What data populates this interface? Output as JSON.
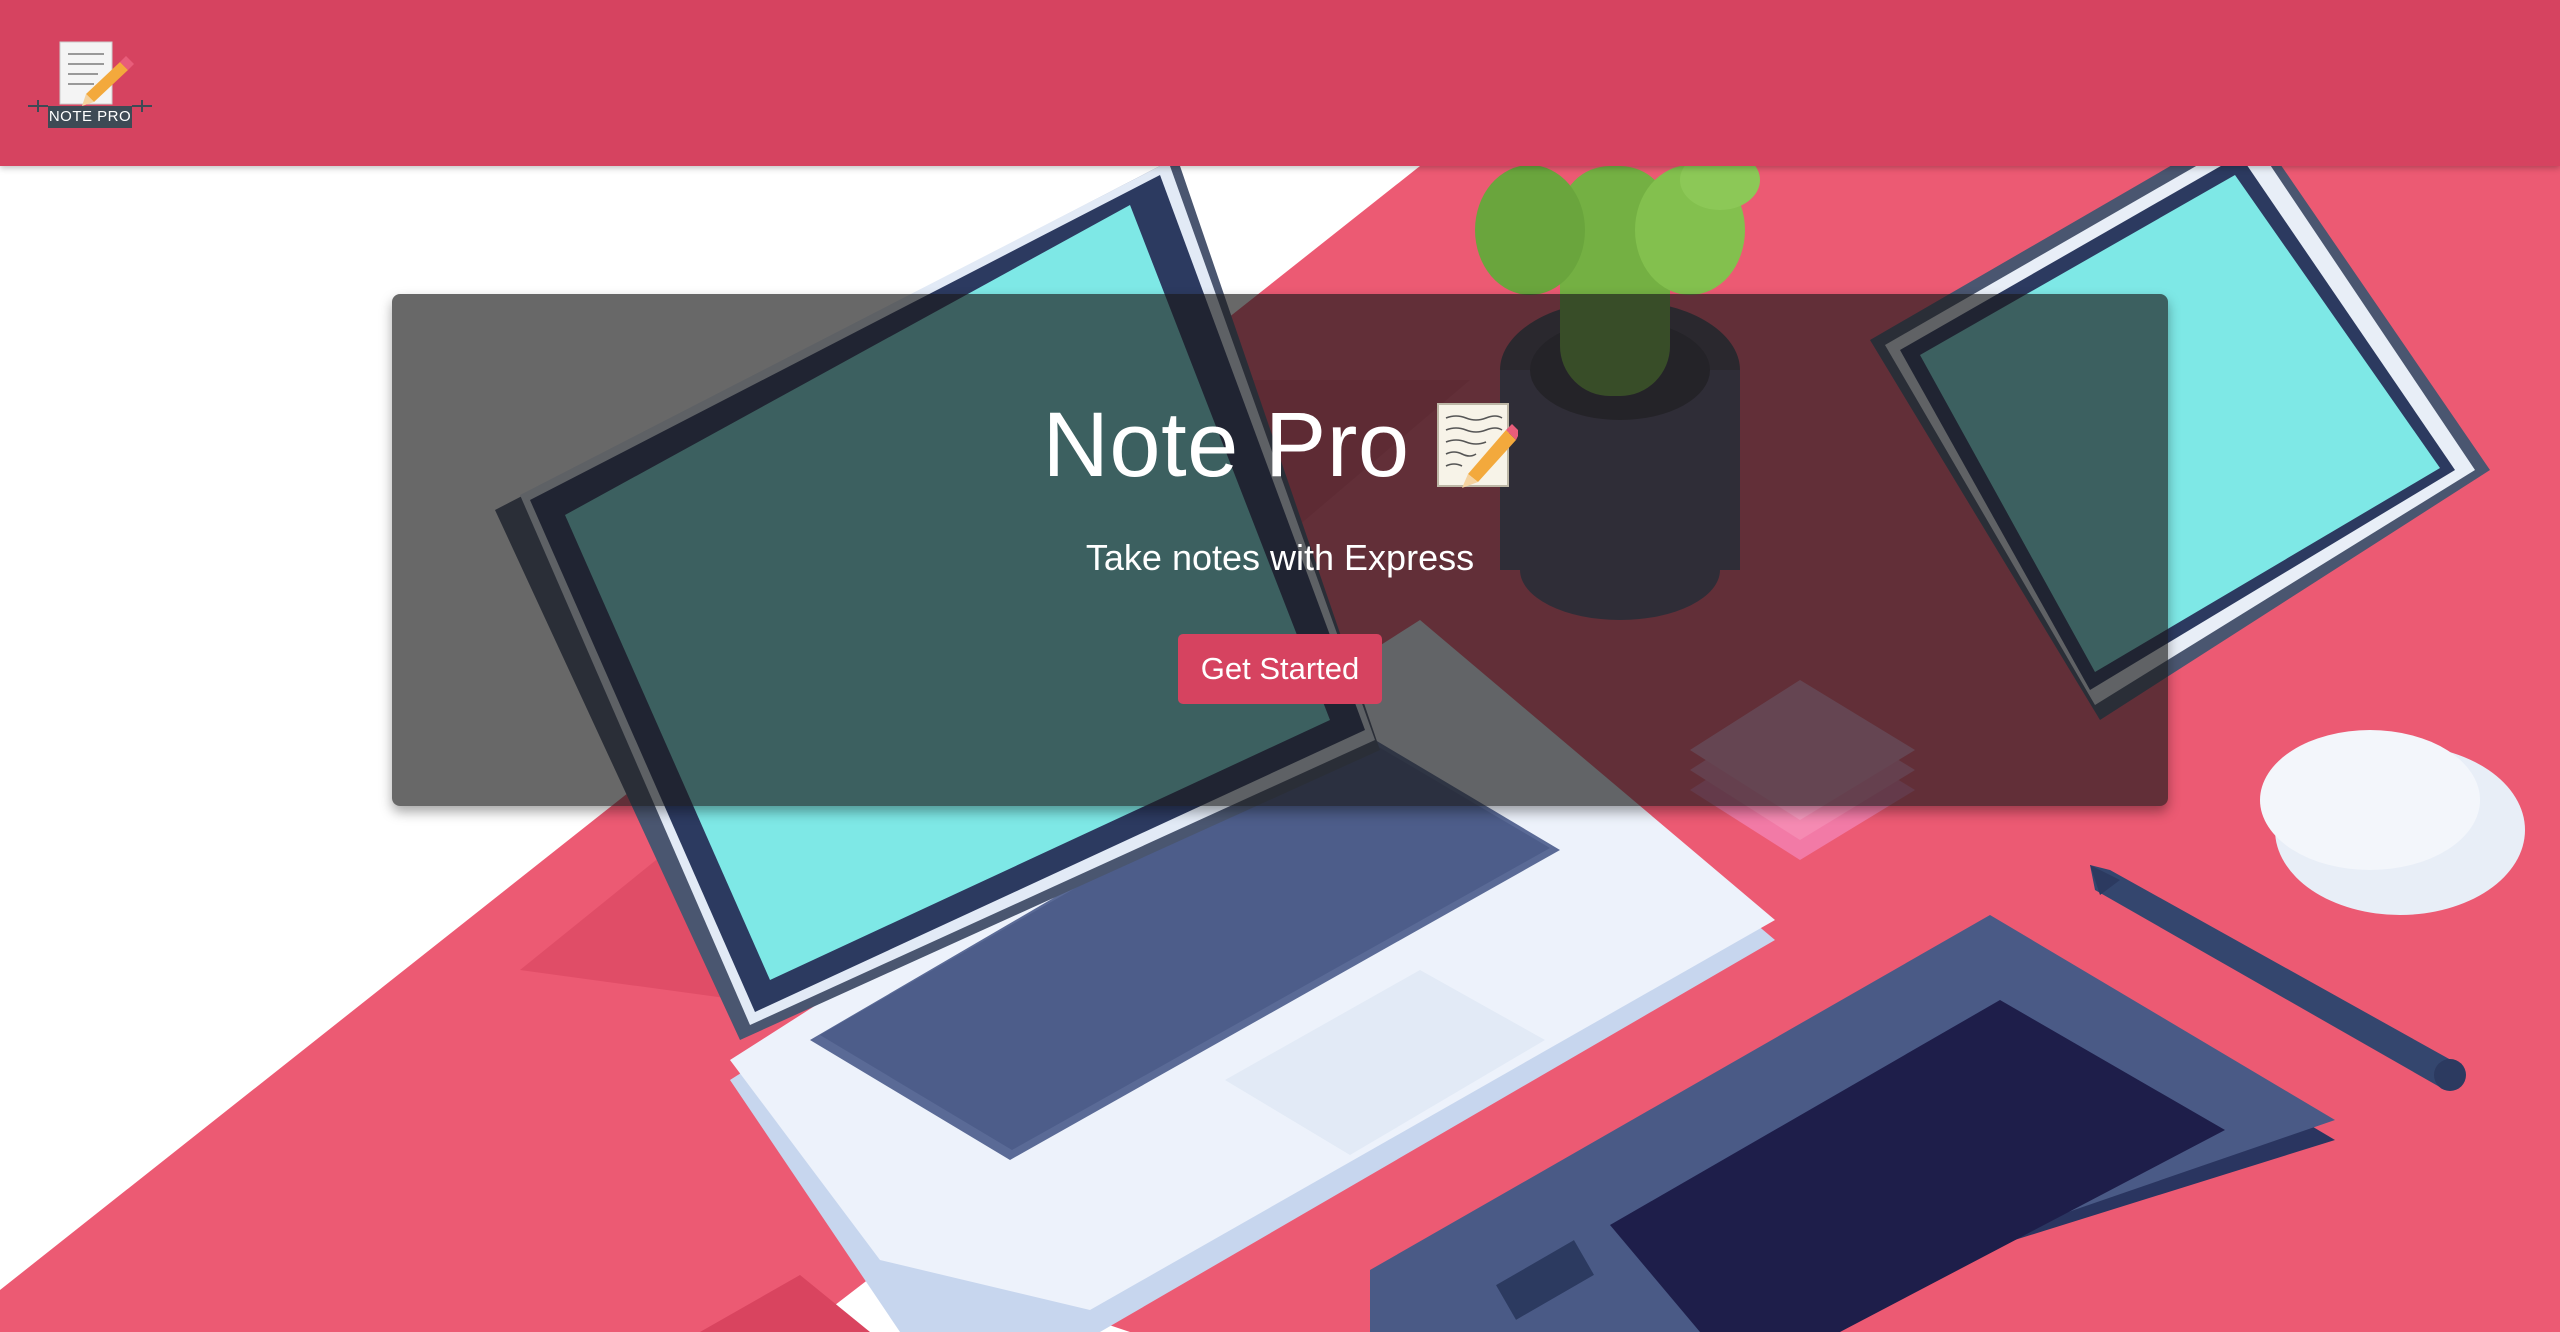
{
  "navbar": {
    "brand_label": "NOTE PRO",
    "brand_icon": "notepad-pencil-icon",
    "background_color": "#d64360"
  },
  "hero": {
    "title": "Note Pro",
    "title_icon": "memo-icon",
    "subtitle": "Take notes with Express",
    "cta_label": "Get Started",
    "cta_color": "#d64360"
  },
  "background": {
    "illustration": "isometric-desk-laptop-cactus-tablet-icon",
    "accent_color": "#ec5a73"
  }
}
